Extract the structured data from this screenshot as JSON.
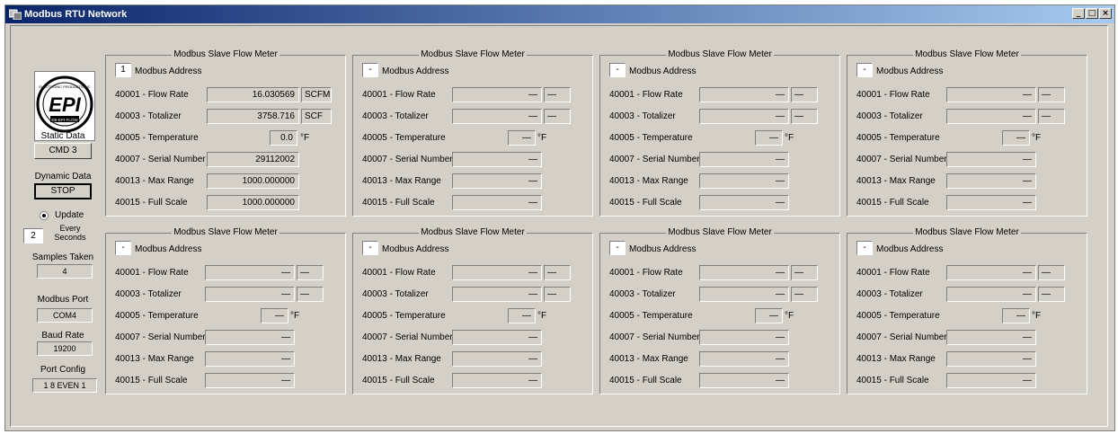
{
  "window": {
    "title": "Modbus RTU Network",
    "minimize": "_",
    "restore": "□",
    "close": "×"
  },
  "logo": {
    "text": "EPI",
    "top_text": "ELECTRONIC PRODUCTS INC",
    "bottom_text": "EB-EPI-FLOW"
  },
  "sidebar": {
    "static_data_label": "Static Data",
    "static_data_button": "CMD 3",
    "dynamic_data_label": "Dynamic Data",
    "dynamic_data_button": "STOP",
    "update_label": "Update",
    "interval_value": "2",
    "interval_label_1": "Every",
    "interval_label_2": "Seconds",
    "samples_label": "Samples Taken",
    "samples_value": "4",
    "port_label": "Modbus Port",
    "port_value": "COM4",
    "baud_label": "Baud Rate",
    "baud_value": "19200",
    "config_label": "Port Config",
    "config_value": "1 8 EVEN 1"
  },
  "labels": {
    "group_title": "Modbus Slave Flow Meter",
    "address": "Modbus Address",
    "flow_rate": "40001 - Flow Rate",
    "totalizer": "40003 - Totalizer",
    "temperature": "40005 - Temperature",
    "serial": "40007 - Serial Number",
    "max_range": "40013 - Max Range",
    "full_scale": "40015 - Full Scale",
    "deg_unit": "°F"
  },
  "meters": [
    {
      "address": "1",
      "flow_rate": "16.030569",
      "flow_unit": "SCFM",
      "totalizer": "3758.716",
      "total_unit": "SCF",
      "temperature": "0.0",
      "serial": "29112002",
      "max_range": "1000.000000",
      "full_scale": "1000.000000"
    },
    {
      "address": "-",
      "flow_rate": "—",
      "flow_unit": "—",
      "totalizer": "—",
      "total_unit": "—",
      "temperature": "—",
      "serial": "—",
      "max_range": "—",
      "full_scale": "—"
    },
    {
      "address": "-",
      "flow_rate": "—",
      "flow_unit": "—",
      "totalizer": "—",
      "total_unit": "—",
      "temperature": "—",
      "serial": "—",
      "max_range": "—",
      "full_scale": "—"
    },
    {
      "address": "-",
      "flow_rate": "—",
      "flow_unit": "—",
      "totalizer": "—",
      "total_unit": "—",
      "temperature": "—",
      "serial": "—",
      "max_range": "—",
      "full_scale": "—"
    },
    {
      "address": "-",
      "flow_rate": "—",
      "flow_unit": "—",
      "totalizer": "—",
      "total_unit": "—",
      "temperature": "—",
      "serial": "—",
      "max_range": "—",
      "full_scale": "—"
    },
    {
      "address": "-",
      "flow_rate": "—",
      "flow_unit": "—",
      "totalizer": "—",
      "total_unit": "—",
      "temperature": "—",
      "serial": "—",
      "max_range": "—",
      "full_scale": "—"
    },
    {
      "address": "-",
      "flow_rate": "—",
      "flow_unit": "—",
      "totalizer": "—",
      "total_unit": "—",
      "temperature": "—",
      "serial": "—",
      "max_range": "—",
      "full_scale": "—"
    },
    {
      "address": "-",
      "flow_rate": "—",
      "flow_unit": "—",
      "totalizer": "—",
      "total_unit": "—",
      "temperature": "—",
      "serial": "—",
      "max_range": "—",
      "full_scale": "—"
    }
  ]
}
